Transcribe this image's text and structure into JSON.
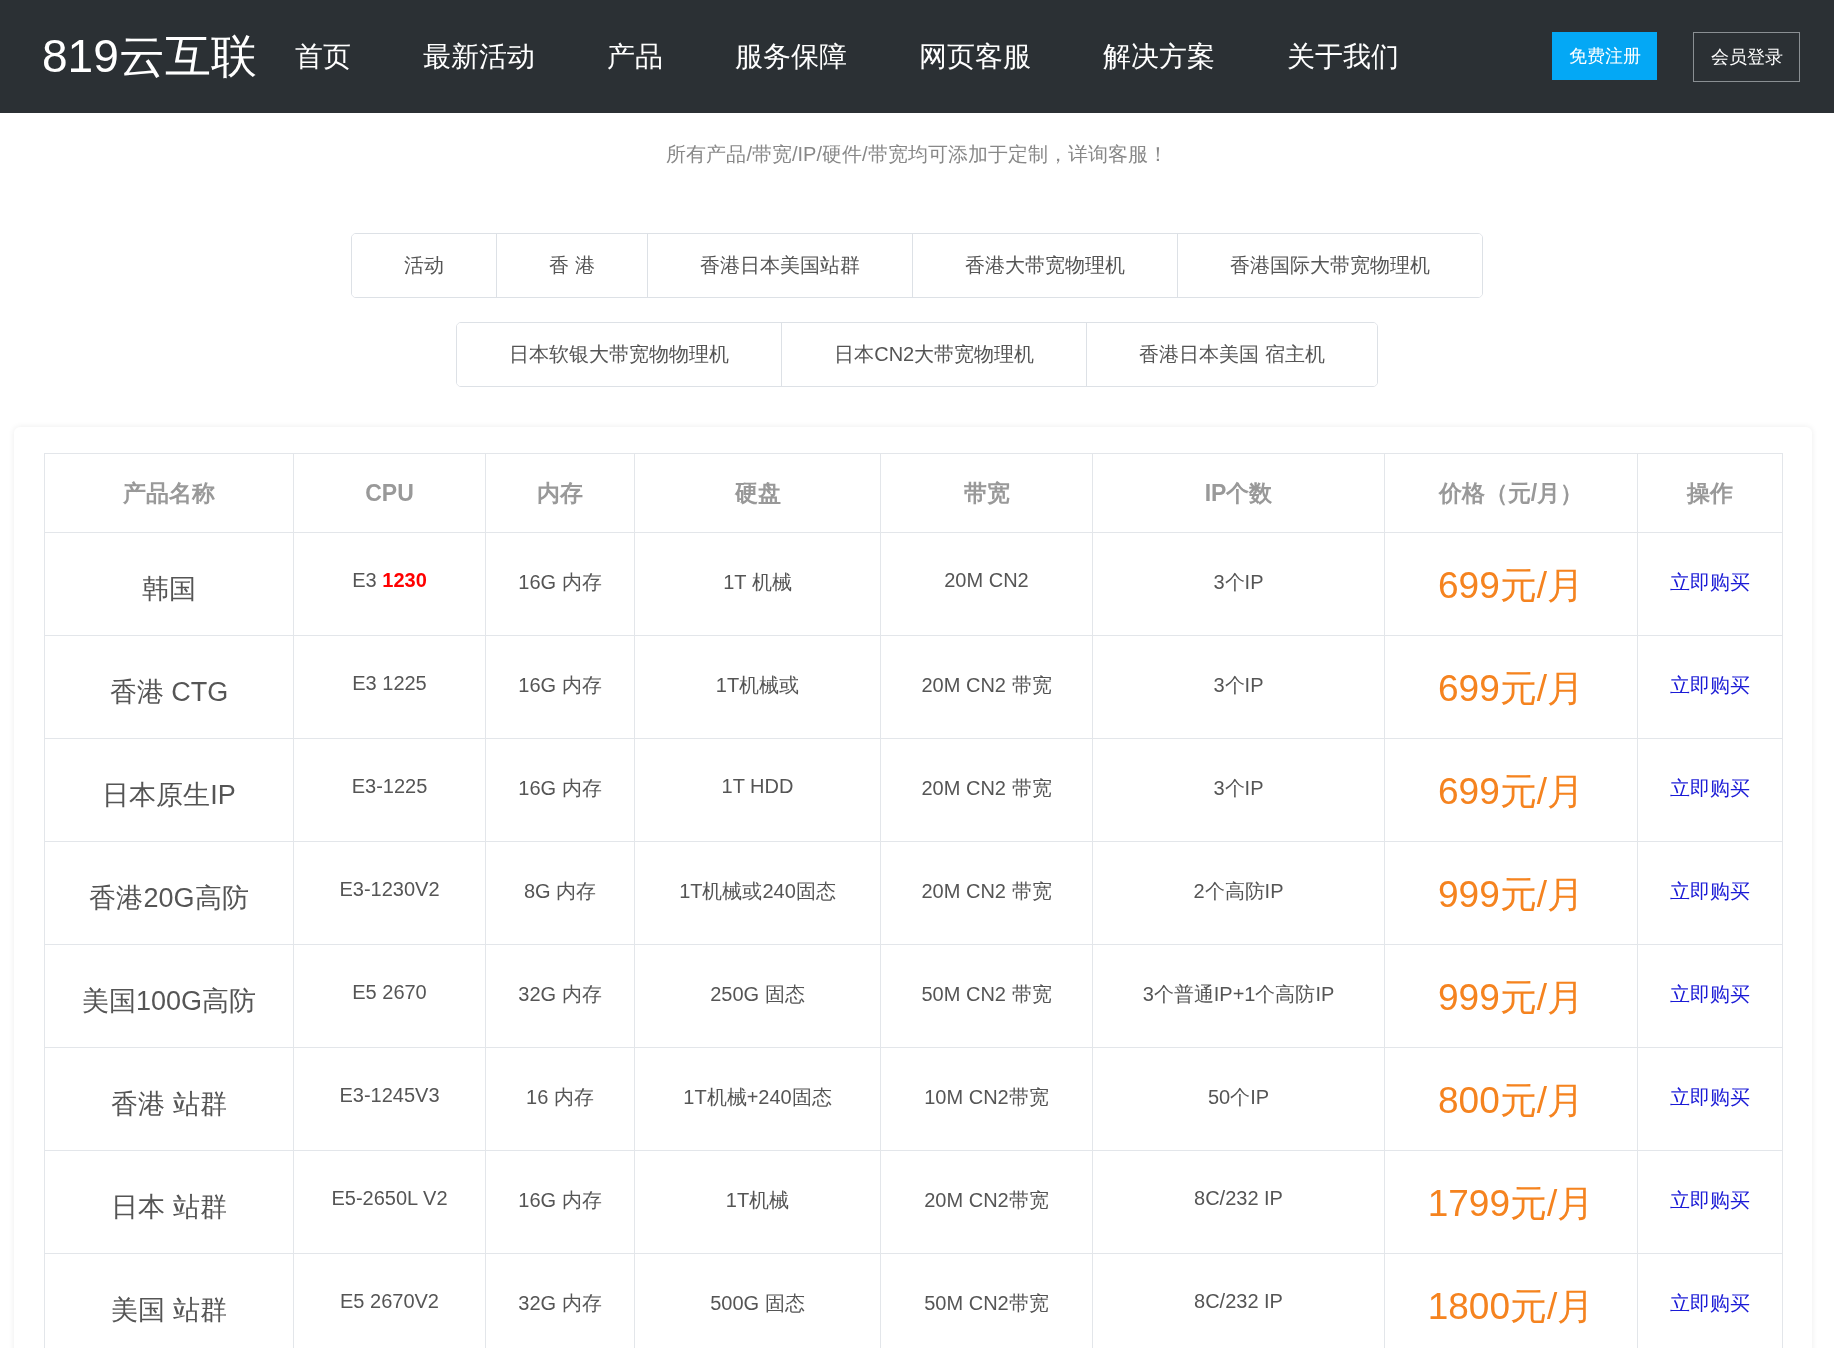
{
  "header": {
    "logo": "819云互联",
    "nav": [
      "首页",
      "最新活动",
      "产品",
      "服务保障",
      "网页客服",
      "解决方案",
      "关于我们"
    ],
    "register_button": "免费注册",
    "login_button": "会员登录"
  },
  "subtitle": "所有产品/带宽/IP/硬件/带宽均可添加于定制，详询客服！",
  "category_tabs": [
    [
      {
        "label": "活动",
        "selected": false
      },
      {
        "label": "香 港",
        "selected": false
      },
      {
        "label": "香港日本美国站群",
        "selected": false
      },
      {
        "label": "香港大带宽物理机",
        "selected": false
      },
      {
        "label": "香港国际大带宽物理机",
        "selected": false
      }
    ],
    [
      {
        "label": "日本软银大带宽物物理机",
        "selected": false
      },
      {
        "label": "日本CN2大带宽物理机",
        "selected": false
      },
      {
        "label": "香港日本美国 宿主机",
        "selected": false
      }
    ]
  ],
  "table": {
    "columns": [
      "产品名称",
      "CPU",
      "内存",
      "硬盘",
      "带宽",
      "IP个数",
      "价格（元/月）",
      "操作"
    ],
    "rows": [
      {
        "name": "韩国",
        "cpu": "E3 **1230**",
        "memory": "16G 内存",
        "disk": "1T 机械",
        "bandwidth": "20M CN2",
        "ips": "3个IP",
        "price": "699元/月",
        "action": "立即购买"
      },
      {
        "name": "香港 CTG",
        "cpu": "E3 1225",
        "memory": "16G 内存",
        "disk": "1T机械或",
        "bandwidth": "20M CN2 带宽",
        "ips": "3个IP",
        "price": "699元/月",
        "action": "立即购买"
      },
      {
        "name": "日本原生IP",
        "cpu": "E3-1225",
        "memory": "16G 内存",
        "disk": "1T HDD",
        "bandwidth": "20M CN2 带宽",
        "ips": "3个IP",
        "price": "699元/月",
        "action": "立即购买"
      },
      {
        "name": "香港20G高防",
        "cpu": "E3-1230V2",
        "memory": "8G 内存",
        "disk": "1T机械或240固态",
        "bandwidth": "20M CN2 带宽",
        "ips": "2个高防IP",
        "price": "999元/月",
        "action": "立即购买"
      },
      {
        "name": "美国100G高防",
        "cpu": "E5 2670",
        "memory": "32G 内存",
        "disk": "250G 固态",
        "bandwidth": "50M CN2 带宽",
        "ips": "3个普通IP+1个高防IP",
        "price": "999元/月",
        "action": "立即购买"
      },
      {
        "name": "香港 站群",
        "cpu": "E3-1245V3",
        "memory": "16 内存",
        "disk": "1T机械+240固态",
        "bandwidth": "10M CN2带宽",
        "ips": "50个IP",
        "price": "800元/月",
        "action": "立即购买"
      },
      {
        "name": "日本 站群",
        "cpu": "E5-2650L V2",
        "memory": "16G 内存",
        "disk": "1T机械",
        "bandwidth": "20M CN2带宽",
        "ips": "8C/232 IP",
        "price": "1799元/月",
        "action": "立即购买"
      },
      {
        "name": "美国 站群",
        "cpu": "E5 2670V2",
        "memory": "32G 内存",
        "disk": "500G 固态",
        "bandwidth": "50M CN2带宽",
        "ips": "8C/232 IP",
        "price": "1800元/月",
        "action": "立即购买"
      }
    ]
  }
}
